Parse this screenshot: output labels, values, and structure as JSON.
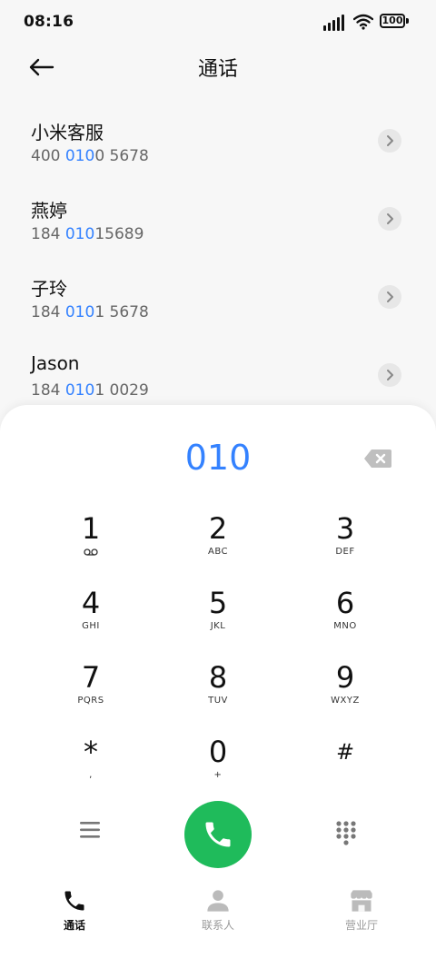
{
  "status_bar": {
    "time": "08:16",
    "battery": "100",
    "icons": [
      "signal-icon",
      "wifi-icon",
      "battery-icon"
    ]
  },
  "header": {
    "title": "通话",
    "back_icon": "back-arrow-icon"
  },
  "contacts": [
    {
      "name": "小米客服",
      "number_prefix": "400 ",
      "number_match": "010",
      "number_suffix": "0 5678",
      "match_color": "#3482ff"
    },
    {
      "name": "燕婷",
      "number_prefix": "184 ",
      "number_match": "010",
      "number_suffix": "15689"
    },
    {
      "name": "子玲",
      "number_prefix": "184 ",
      "number_match": "010",
      "number_suffix": "1 5678"
    },
    {
      "name": "Jason",
      "number_prefix": "184 ",
      "number_match": "010",
      "number_suffix": "1 0029"
    }
  ],
  "dialer": {
    "dialed_number": "010",
    "keys": [
      {
        "digit": "1",
        "letters": "",
        "icon": "voicemail-icon"
      },
      {
        "digit": "2",
        "letters": "ABC"
      },
      {
        "digit": "3",
        "letters": "DEF"
      },
      {
        "digit": "4",
        "letters": "GHI"
      },
      {
        "digit": "5",
        "letters": "JKL"
      },
      {
        "digit": "6",
        "letters": "MNO"
      },
      {
        "digit": "7",
        "letters": "PQRS"
      },
      {
        "digit": "8",
        "letters": "TUV"
      },
      {
        "digit": "9",
        "letters": "WXYZ"
      },
      {
        "digit": "*",
        "letters": ","
      },
      {
        "digit": "0",
        "letters": "+"
      },
      {
        "digit": "#",
        "letters": ""
      }
    ],
    "call_color": "#1fbb5b"
  },
  "bottom_nav": {
    "tabs": [
      {
        "label": "通话",
        "icon": "phone-icon",
        "active": true
      },
      {
        "label": "联系人",
        "icon": "person-icon",
        "active": false
      },
      {
        "label": "营业厅",
        "icon": "store-icon",
        "active": false
      }
    ]
  }
}
